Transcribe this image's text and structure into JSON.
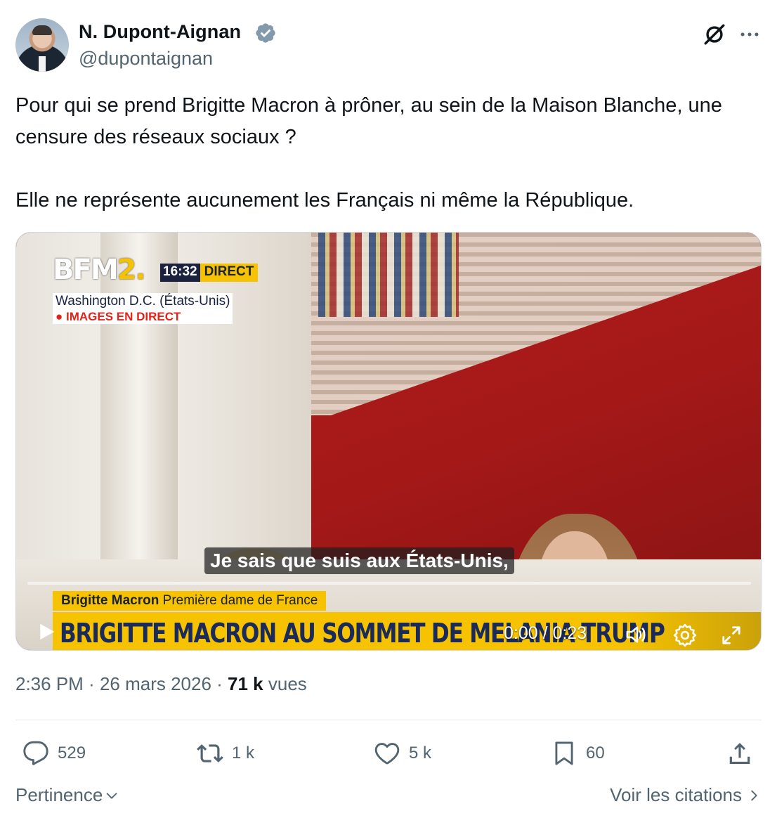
{
  "author": {
    "display_name": "N. Dupont-Aignan",
    "handle": "@dupontaignan",
    "verified_icon": "verified-badge-icon",
    "verified_color": "#829aab"
  },
  "tweet": {
    "paragraphs": [
      "Pour qui se prend Brigitte Macron à prôner, au sein de la Maison Blanche, une censure des réseaux sociaux ?",
      "Elle ne représente aucunement les Français ni même la République."
    ]
  },
  "video": {
    "channel_logo": "BFM",
    "channel_logo_suffix": "2.",
    "time": "16:32",
    "live_badge": "DIRECT",
    "location": "Washington D.C. (États-Unis)",
    "live_label": "● IMAGES EN DIRECT",
    "subtitle": "Je sais que suis aux États-Unis,",
    "lower_third_name": "Brigitte Macron",
    "lower_third_role": "Première dame de France",
    "banner": "BRIGITTE MACRON AU SOMMET DE MELANIA TRUMP",
    "timecode": "0:00 / 0:23",
    "progress": 0,
    "accent_yellow": "#f7c300",
    "navy": "#1a2240"
  },
  "meta": {
    "time": "2:36 PM",
    "sep1": " · ",
    "date": "26 mars 2026",
    "sep2": " · ",
    "views_count": "71 k",
    "views_label": " vues"
  },
  "actions": {
    "replies": "529",
    "retweets": "1 k",
    "likes": "5 k",
    "bookmarks": "60"
  },
  "footer": {
    "sort_label": "Pertinence",
    "quotes_label": "Voir les citations"
  },
  "colors": {
    "text_primary": "#0f1419",
    "text_secondary": "#536471",
    "divider": "#e1e8ed"
  }
}
